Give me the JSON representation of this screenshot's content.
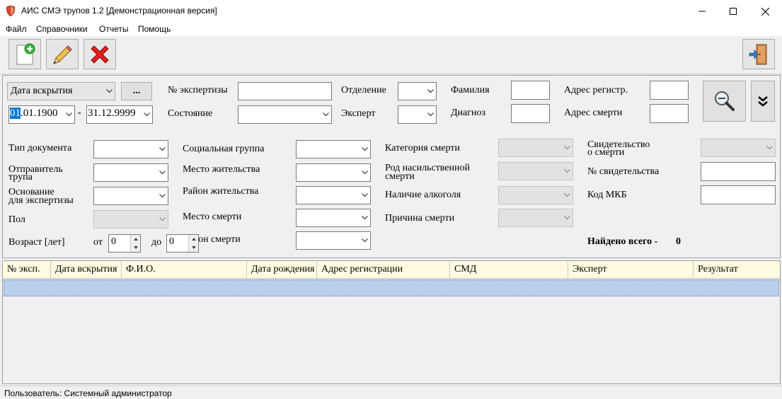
{
  "window": {
    "title": "АИС СМЭ трупов 1.2 [Демонстрационная версия]"
  },
  "menu": {
    "items": [
      {
        "label": "Файл"
      },
      {
        "label": "Справочники"
      },
      {
        "label": "Отчеты"
      },
      {
        "label": "Помощь"
      }
    ]
  },
  "filter": {
    "date_type": {
      "value": "Дата вскрытия"
    },
    "browse_label": "...",
    "date_from": {
      "selected": "01",
      "rest": ".01.1900"
    },
    "date_separator": "-",
    "date_to": "31.12.9999",
    "labels": {
      "exam_no": "№ экспертизы",
      "state": "Состояние",
      "department": "Отделение",
      "expert": "Эксперт",
      "surname": "Фамилия",
      "diagnosis": "Диагноз",
      "reg_address": "Адрес регистр.",
      "death_address": "Адрес смерти",
      "doc_type": "Тип документа",
      "sender_1": "Отправитель",
      "sender_2": "трупа",
      "basis_1": "Основание",
      "basis_2": "для экспертизы",
      "sex": "Пол",
      "age": "Возраст [лет]",
      "age_from": "от",
      "age_to": "до",
      "social_group": "Социальная группа",
      "residence": "Место жительства",
      "residence_district": "Район жительства",
      "death_place": "Место смерти",
      "death_district_partial": "он смерти",
      "death_category": "Категория смерти",
      "violent_1": "Род насильственной",
      "violent_2": "смерти",
      "alcohol": "Наличие алкоголя",
      "death_cause": "Причина смерти",
      "certificate_1": "Свидетельство",
      "certificate_2": "о смерти",
      "certificate_no": "№ свидетельства",
      "icd_code": "Код МКБ",
      "found_total": "Найдено всего -"
    },
    "age_from_value": "0",
    "age_to_value": "0",
    "found_count": "0"
  },
  "grid": {
    "columns": [
      {
        "label": "№ эксп."
      },
      {
        "label": "Дата вскрытия"
      },
      {
        "label": "Ф.И.О."
      },
      {
        "label": "Дата рождения"
      },
      {
        "label": "Адрес регистрации"
      },
      {
        "label": "СМД"
      },
      {
        "label": "Эксперт"
      },
      {
        "label": "Результат"
      }
    ]
  },
  "status": {
    "user": "Пользователь: Системный администратор"
  },
  "icons": {
    "app": "shield-icon",
    "add": "add-document-icon",
    "edit": "pencil-icon",
    "delete": "red-x-icon",
    "exit": "exit-door-icon",
    "search": "magnifier-icon",
    "expand": "double-chevron-down-icon"
  },
  "colors": {
    "selected_row": "#b8d0ec",
    "grid_header": "#fffbe0",
    "date_highlight": "#0078d7"
  }
}
